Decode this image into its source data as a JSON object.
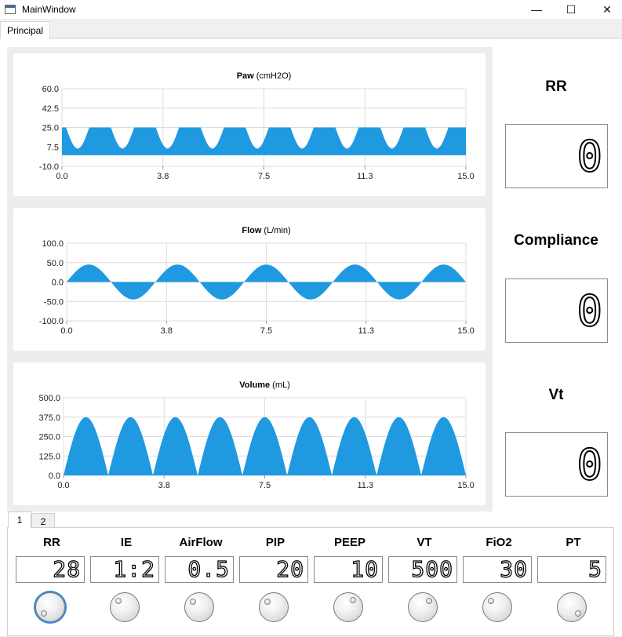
{
  "window": {
    "title": "MainWindow",
    "minimize": "—",
    "maximize": "☐",
    "close": "✕"
  },
  "tabs": {
    "main": "Principal"
  },
  "charts": [
    {
      "title": "Paw",
      "unit": "(cmH2O)",
      "chart_data": {
        "type": "area",
        "title": "Paw (cmH2O)",
        "xlim": [
          0,
          15
        ],
        "ylim": [
          -10,
          60
        ],
        "x_ticks": [
          "0.0",
          "3.8",
          "7.5",
          "11.3",
          "15.0"
        ],
        "y_ticks": [
          "60.0",
          "42.5",
          "25.0",
          "7.5",
          "-10.0"
        ],
        "series": [
          {
            "shape": "pressure-cycle",
            "period": 1.667,
            "peak": 25,
            "trough": 5,
            "baseline": 0
          }
        ]
      }
    },
    {
      "title": "Flow",
      "unit": "(L/min)",
      "chart_data": {
        "type": "area",
        "title": "Flow (L/min)",
        "xlim": [
          0,
          15
        ],
        "ylim": [
          -100,
          100
        ],
        "x_ticks": [
          "0.0",
          "3.8",
          "7.5",
          "11.3",
          "15.0"
        ],
        "y_ticks": [
          "100.0",
          "50.0",
          "0.0",
          "-50.0",
          "-100.0"
        ],
        "series": [
          {
            "shape": "sine",
            "period": 3.333,
            "amplitude": 45,
            "baseline": 0
          }
        ]
      }
    },
    {
      "title": "Volume",
      "unit": "(mL)",
      "chart_data": {
        "type": "area",
        "title": "Volume (mL)",
        "xlim": [
          0,
          15
        ],
        "ylim": [
          0,
          500
        ],
        "x_ticks": [
          "0.0",
          "3.8",
          "7.5",
          "11.3",
          "15.0"
        ],
        "y_ticks": [
          "500.0",
          "375.0",
          "250.0",
          "125.0",
          "0.0"
        ],
        "series": [
          {
            "shape": "rectified-sine",
            "period": 1.667,
            "peak": 375,
            "baseline": 0
          }
        ]
      }
    }
  ],
  "side": [
    {
      "label": "RR",
      "value": "0"
    },
    {
      "label": "Compliance",
      "value": "0"
    },
    {
      "label": "Vt",
      "value": "0"
    }
  ],
  "bottom_tabs": [
    "1",
    "2"
  ],
  "controls": [
    {
      "label": "RR",
      "value": "28",
      "dot_angle": 135
    },
    {
      "label": "IE",
      "value": "1:2",
      "dot_angle": 225
    },
    {
      "label": "AirFlow",
      "value": "0.5",
      "dot_angle": 220
    },
    {
      "label": "PIP",
      "value": "20",
      "dot_angle": 220
    },
    {
      "label": "PEEP",
      "value": "10",
      "dot_angle": 305
    },
    {
      "label": "VT",
      "value": "500",
      "dot_angle": 315
    },
    {
      "label": "FiO2",
      "value": "30",
      "dot_angle": 225
    },
    {
      "label": "PT",
      "value": "5",
      "dot_angle": 45
    }
  ],
  "colors": {
    "fill": "#1f9ae0",
    "grid": "#dcdcdc",
    "focus": "#3a87d6"
  }
}
